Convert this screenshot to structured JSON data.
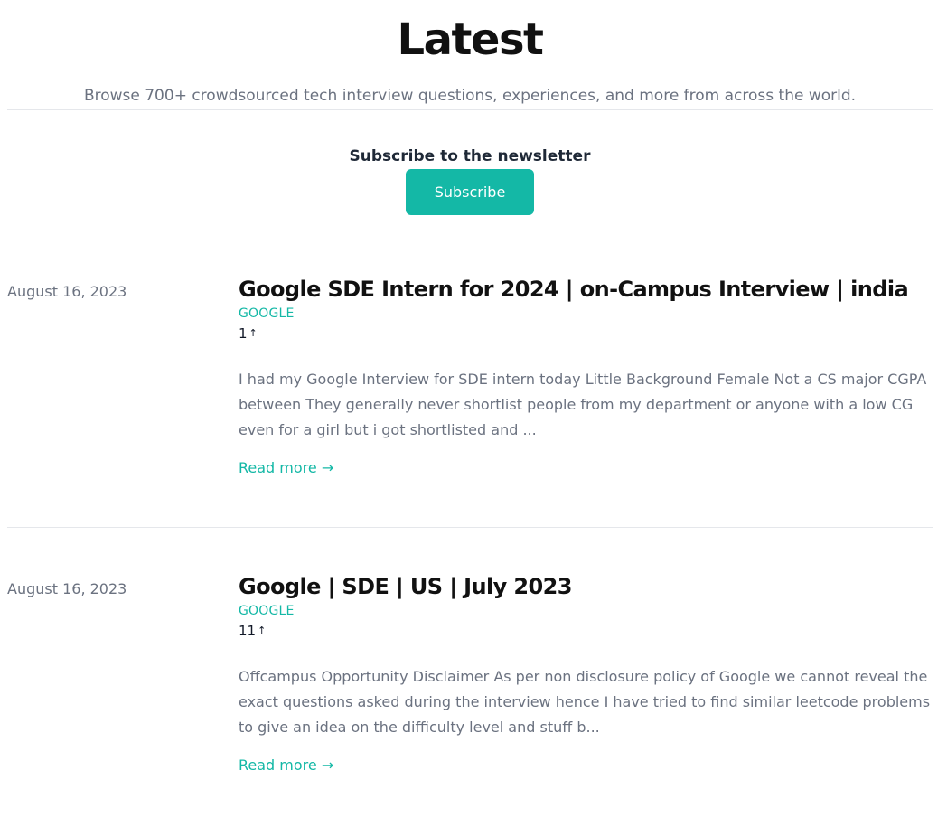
{
  "header": {
    "title": "Latest",
    "subtitle": "Browse 700+ crowdsourced tech interview questions, experiences, and more from across the world."
  },
  "newsletter": {
    "heading": "Subscribe to the newsletter",
    "button_label": "Subscribe"
  },
  "colors": {
    "accent": "#14b8a6",
    "muted_text": "#6b7280",
    "heading_text": "#111111",
    "divider": "#e5e7eb"
  },
  "icons": {
    "vote": "arrow-up-icon"
  },
  "posts": [
    {
      "date": "August 16, 2023",
      "title": "Google SDE Intern for 2024 | on-Campus Interview | india",
      "tag": "GOOGLE",
      "votes": "1",
      "vote_glyph": "↑",
      "excerpt": "I had my Google Interview for SDE intern today Little Background Female Not a CS major CGPA between They generally never shortlist people from my department or anyone with a low CG even for a girl but i got shortlisted and ...",
      "read_more": "Read more →"
    },
    {
      "date": "August 16, 2023",
      "title": "Google | SDE | US | July 2023",
      "tag": "GOOGLE",
      "votes": "11",
      "vote_glyph": "↑",
      "excerpt": "Offcampus Opportunity Disclaimer As per non disclosure policy of Google we cannot reveal the exact questions asked during the interview hence I have tried to find similar leetcode problems to give an idea on the difficulty level and stuff b...",
      "read_more": "Read more →"
    }
  ]
}
